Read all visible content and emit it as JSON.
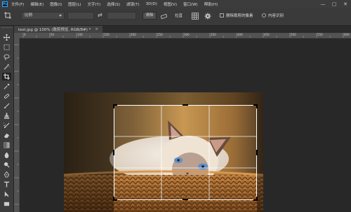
{
  "menubar": {
    "logo": "Ps",
    "items": [
      "文件(F)",
      "编辑(E)",
      "图像(I)",
      "图层(L)",
      "文字(Y)",
      "选择(S)",
      "滤镜(T)",
      "3D(D)",
      "视图(V)",
      "窗口(W)",
      "帮助(H)"
    ],
    "minimize": "—",
    "maximize": "▢",
    "close": "✕"
  },
  "options": {
    "ratio_select": "比例",
    "swap_icon": "⇄",
    "clear_button": "清除",
    "straighten_label": "拉直",
    "delete_cropped_label": "删除裁剪的像素",
    "content_aware_label": "内容识别"
  },
  "document": {
    "tab_title": "test.jpg @ 100% (裁剪预览, RGB/8#) *",
    "tab_close": "×"
  },
  "ruler": {
    "h_labels": [
      "0",
      "50",
      "100",
      "150",
      "200",
      "250",
      "300",
      "350",
      "400",
      "450",
      "500",
      "550",
      "600"
    ]
  },
  "colors": {
    "accent": "#31a8ff",
    "background": "#282828",
    "panel": "#3c3c3c"
  }
}
